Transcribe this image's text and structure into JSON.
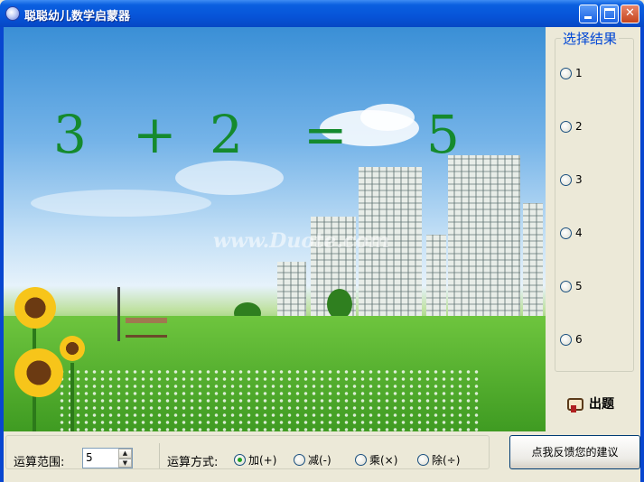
{
  "window": {
    "title": "聪聪幼儿数学启蒙器"
  },
  "equation": {
    "a": "3",
    "operator": "+",
    "b": "2",
    "equals": "=",
    "result": "5"
  },
  "scene": {
    "watermark": "www.Duote.com"
  },
  "choices": {
    "title": "选择结果",
    "options": [
      {
        "label": "1",
        "selected": false
      },
      {
        "label": "2",
        "selected": false
      },
      {
        "label": "3",
        "selected": false
      },
      {
        "label": "4",
        "selected": false
      },
      {
        "label": "5",
        "selected": false
      },
      {
        "label": "6",
        "selected": false
      }
    ]
  },
  "actions": {
    "question_label": "出题",
    "feedback_label": "点我反馈您的建议"
  },
  "settings": {
    "range_label": "运算范围:",
    "range_value": "5",
    "operation_label": "运算方式:",
    "operations": [
      {
        "label": "加(+)",
        "selected": true
      },
      {
        "label": "减(-)",
        "selected": false
      },
      {
        "label": "乘(×)",
        "selected": false
      },
      {
        "label": "除(÷)",
        "selected": false
      }
    ]
  },
  "colors": {
    "equation": "#158a2e",
    "group_title": "#0046d5",
    "titlebar": "#0754d8"
  },
  "icons": {
    "app": "app-orb-icon",
    "question": "hand-card-icon"
  }
}
